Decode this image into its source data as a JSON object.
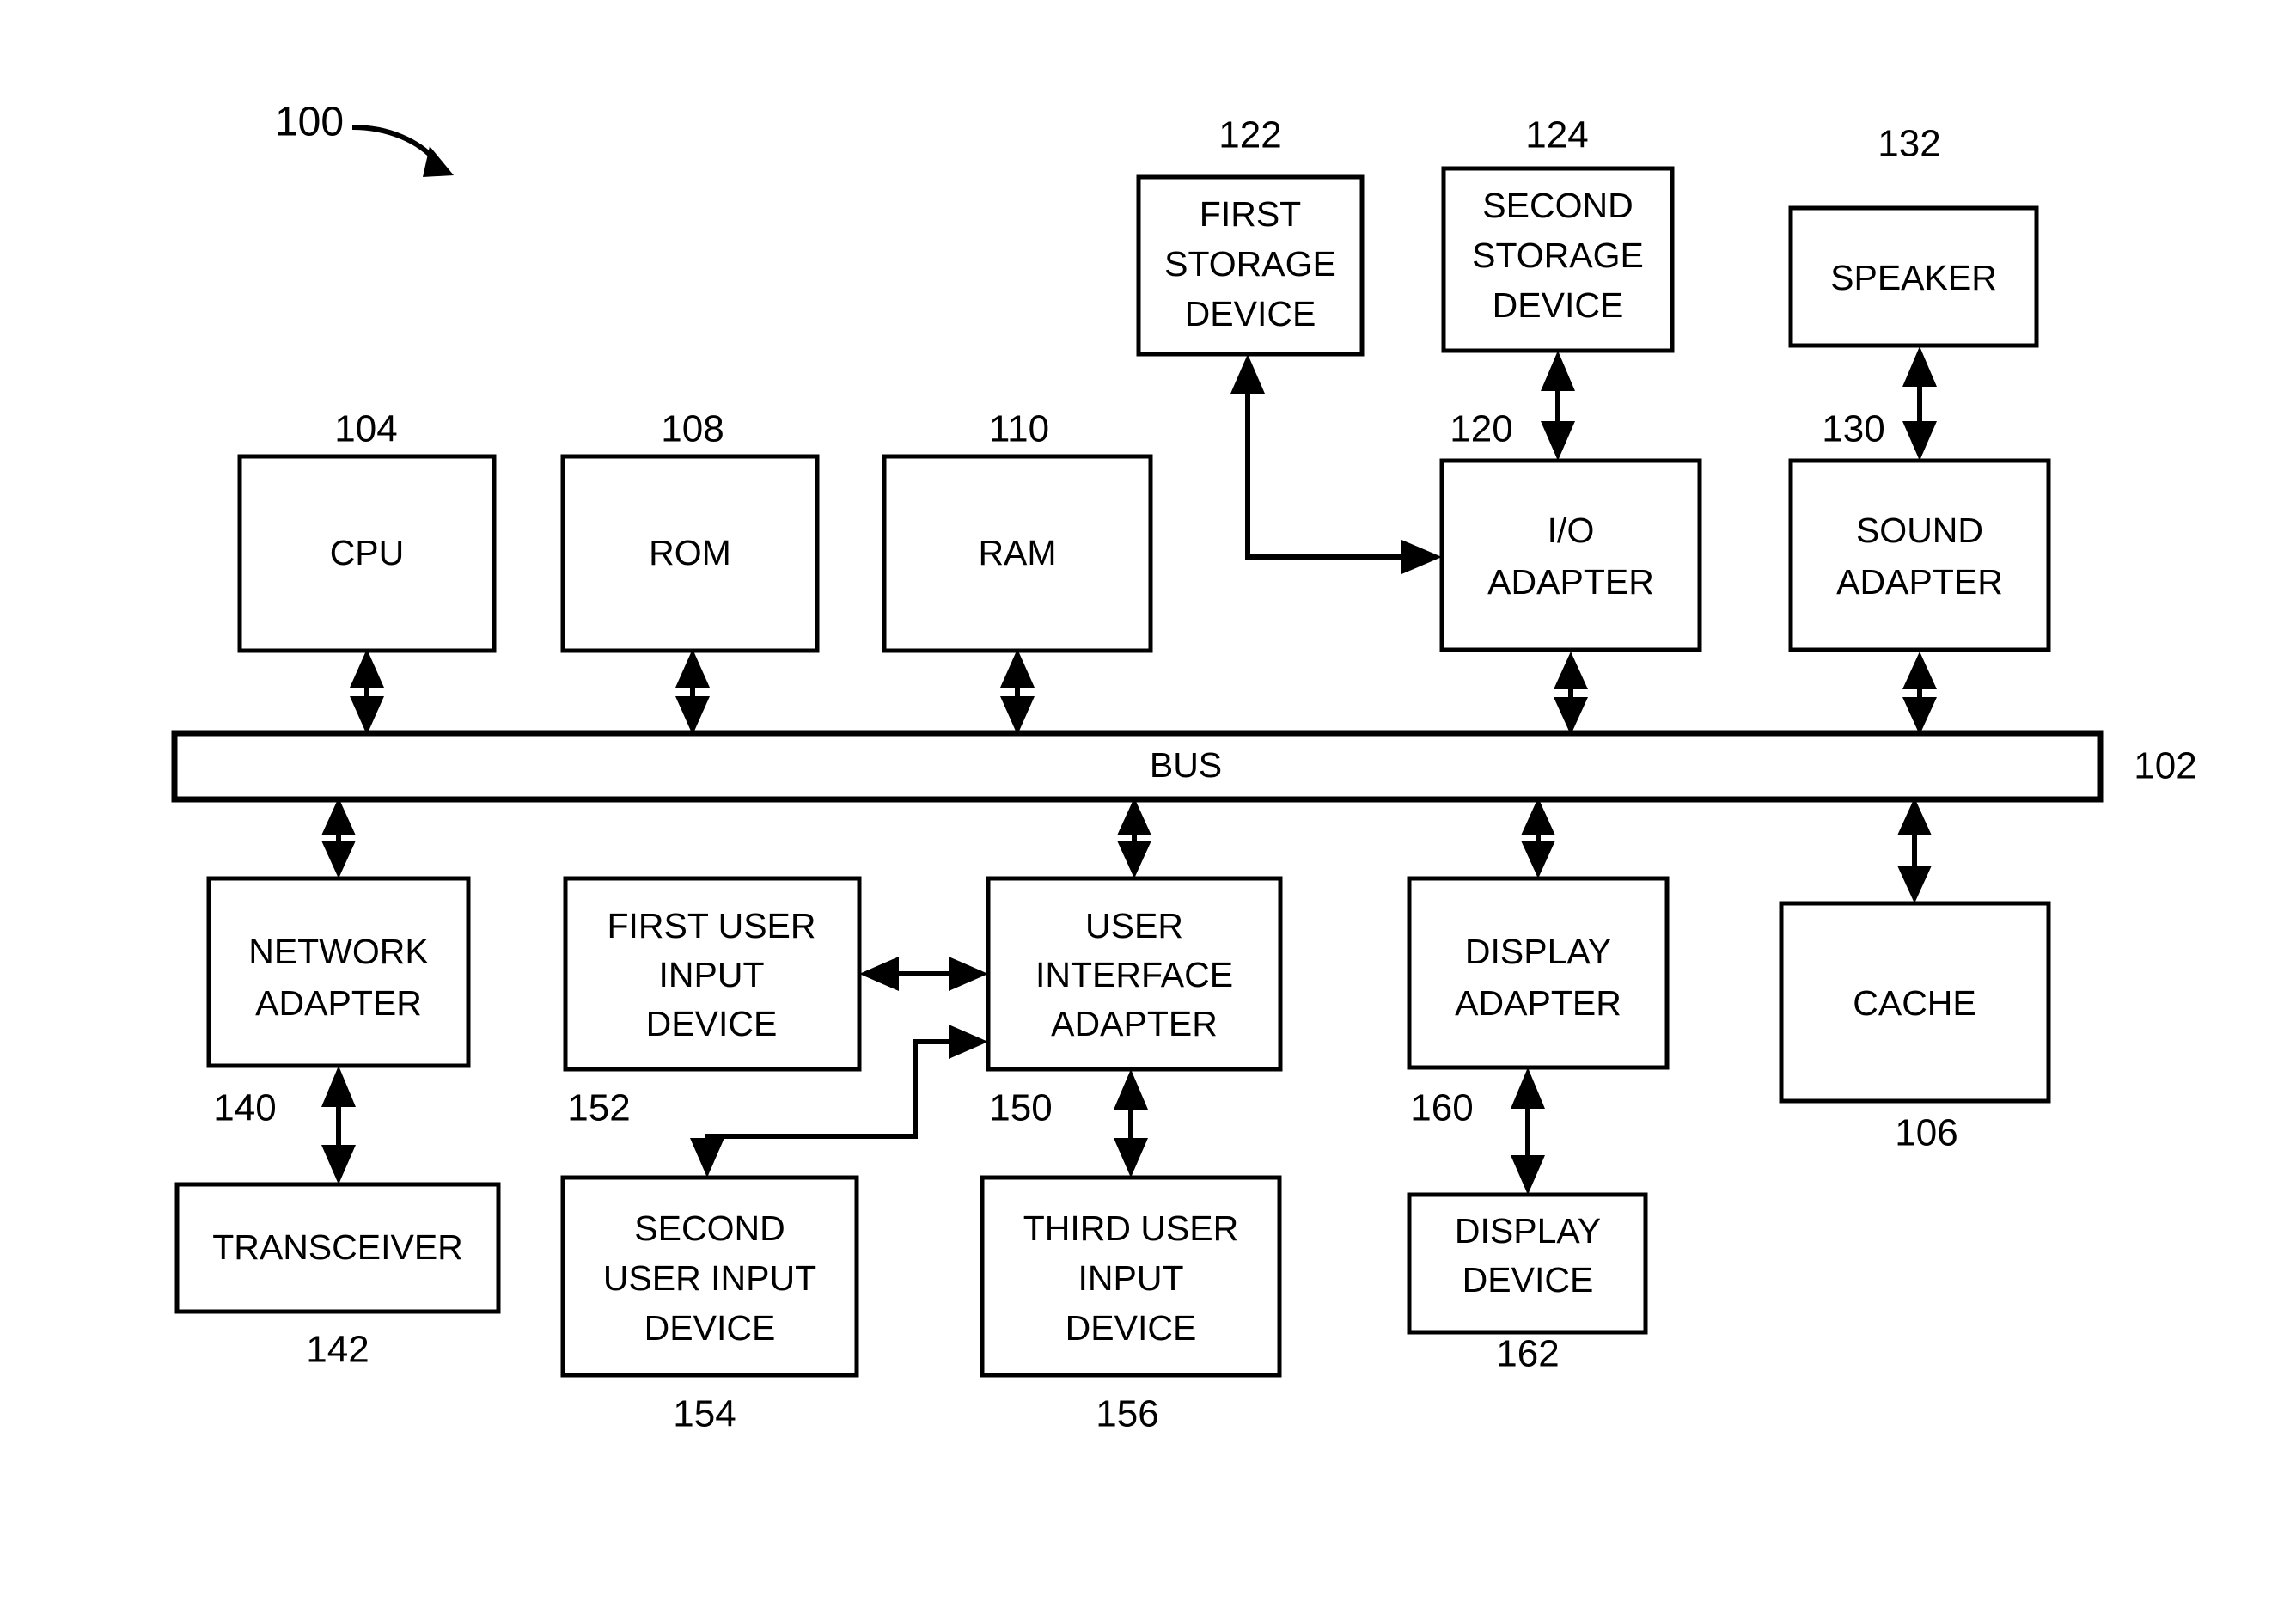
{
  "figure": {
    "number": "100",
    "bus": {
      "label": "BUS",
      "ref": "102"
    }
  },
  "blocks": [
    {
      "id": "first-storage-device",
      "lines": [
        "FIRST",
        "STORAGE",
        "DEVICE"
      ],
      "ref": "122",
      "ref_position": "above"
    },
    {
      "id": "second-storage-device",
      "lines": [
        "SECOND",
        "STORAGE",
        "DEVICE"
      ],
      "ref": "124",
      "ref_position": "above"
    },
    {
      "id": "speaker",
      "lines": [
        "SPEAKER"
      ],
      "ref": "132",
      "ref_position": "above"
    },
    {
      "id": "cpu",
      "lines": [
        "CPU"
      ],
      "ref": "104",
      "ref_position": "above"
    },
    {
      "id": "rom",
      "lines": [
        "ROM"
      ],
      "ref": "108",
      "ref_position": "above"
    },
    {
      "id": "ram",
      "lines": [
        "RAM"
      ],
      "ref": "110",
      "ref_position": "above"
    },
    {
      "id": "io-adapter",
      "lines": [
        "I/O",
        "ADAPTER"
      ],
      "ref": "120",
      "ref_position": "above-left"
    },
    {
      "id": "sound-adapter",
      "lines": [
        "SOUND",
        "ADAPTER"
      ],
      "ref": "130",
      "ref_position": "above-left"
    },
    {
      "id": "network-adapter",
      "lines": [
        "NETWORK",
        "ADAPTER"
      ],
      "ref": "140",
      "ref_position": "below-left"
    },
    {
      "id": "first-user-input-device",
      "lines": [
        "FIRST USER",
        "INPUT",
        "DEVICE"
      ],
      "ref": "152",
      "ref_position": "below-left"
    },
    {
      "id": "user-interface-adapter",
      "lines": [
        "USER",
        "INTERFACE",
        "ADAPTER"
      ],
      "ref": "150",
      "ref_position": "below-left"
    },
    {
      "id": "display-adapter",
      "lines": [
        "DISPLAY",
        "ADAPTER"
      ],
      "ref": "160",
      "ref_position": "below-left"
    },
    {
      "id": "cache",
      "lines": [
        "CACHE"
      ],
      "ref": "106",
      "ref_position": "below"
    },
    {
      "id": "transceiver",
      "lines": [
        "TRANSCEIVER"
      ],
      "ref": "142",
      "ref_position": "below"
    },
    {
      "id": "second-user-input-device",
      "lines": [
        "SECOND",
        "USER INPUT",
        "DEVICE"
      ],
      "ref": "154",
      "ref_position": "below"
    },
    {
      "id": "third-user-input-device",
      "lines": [
        "THIRD USER",
        "INPUT",
        "DEVICE"
      ],
      "ref": "156",
      "ref_position": "below"
    },
    {
      "id": "display-device",
      "lines": [
        "DISPLAY",
        "DEVICE"
      ],
      "ref": "162",
      "ref_position": "below"
    }
  ],
  "labels": {
    "fig_100": "100",
    "ref_102": "102",
    "ref_104": "104",
    "ref_106": "106",
    "ref_108": "108",
    "ref_110": "110",
    "ref_120": "120",
    "ref_122": "122",
    "ref_124": "124",
    "ref_130": "130",
    "ref_132": "132",
    "ref_140": "140",
    "ref_142": "142",
    "ref_150": "150",
    "ref_152": "152",
    "ref_154": "154",
    "ref_156": "156",
    "ref_160": "160",
    "ref_162": "162",
    "bus": "BUS",
    "cpu": "CPU",
    "rom": "ROM",
    "ram": "RAM",
    "cache": "CACHE",
    "speaker": "SPEAKER",
    "transceiver": "TRANSCEIVER",
    "first_storage_1": "FIRST",
    "first_storage_2": "STORAGE",
    "first_storage_3": "DEVICE",
    "second_storage_1": "SECOND",
    "second_storage_2": "STORAGE",
    "second_storage_3": "DEVICE",
    "io_adapter_1": "I/O",
    "io_adapter_2": "ADAPTER",
    "sound_adapter_1": "SOUND",
    "sound_adapter_2": "ADAPTER",
    "network_adapter_1": "NETWORK",
    "network_adapter_2": "ADAPTER",
    "first_uid_1": "FIRST USER",
    "first_uid_2": "INPUT",
    "first_uid_3": "DEVICE",
    "uia_1": "USER",
    "uia_2": "INTERFACE",
    "uia_3": "ADAPTER",
    "display_adapter_1": "DISPLAY",
    "display_adapter_2": "ADAPTER",
    "second_uid_1": "SECOND",
    "second_uid_2": "USER INPUT",
    "second_uid_3": "DEVICE",
    "third_uid_1": "THIRD USER",
    "third_uid_2": "INPUT",
    "third_uid_3": "DEVICE",
    "display_device_1": "DISPLAY",
    "display_device_2": "DEVICE"
  },
  "colors": {
    "stroke": "#000000",
    "background": "#ffffff"
  }
}
